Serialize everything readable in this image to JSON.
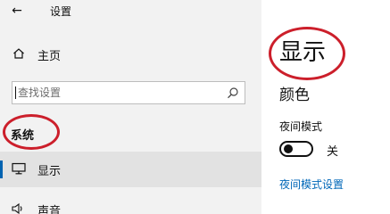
{
  "header": {
    "back_glyph": "←",
    "title": "设置"
  },
  "sidebar": {
    "home_label": "主页",
    "search_placeholder": "查找设置",
    "section_label": "系统",
    "items": [
      {
        "label": "显示",
        "icon": "monitor-icon",
        "selected": true
      },
      {
        "label": "声音",
        "icon": "speaker-icon",
        "selected": false
      }
    ]
  },
  "content": {
    "title": "显示",
    "subtitle": "颜色",
    "night_light_label": "夜间模式",
    "night_light_state": "关",
    "night_light_link": "夜间模式设置"
  },
  "colors": {
    "accent": "#0063b1",
    "link": "#0067b8",
    "annotation": "#cc1f2b",
    "sidebar_bg": "#f2f2f2",
    "selected_bg": "#e2e2e2"
  }
}
